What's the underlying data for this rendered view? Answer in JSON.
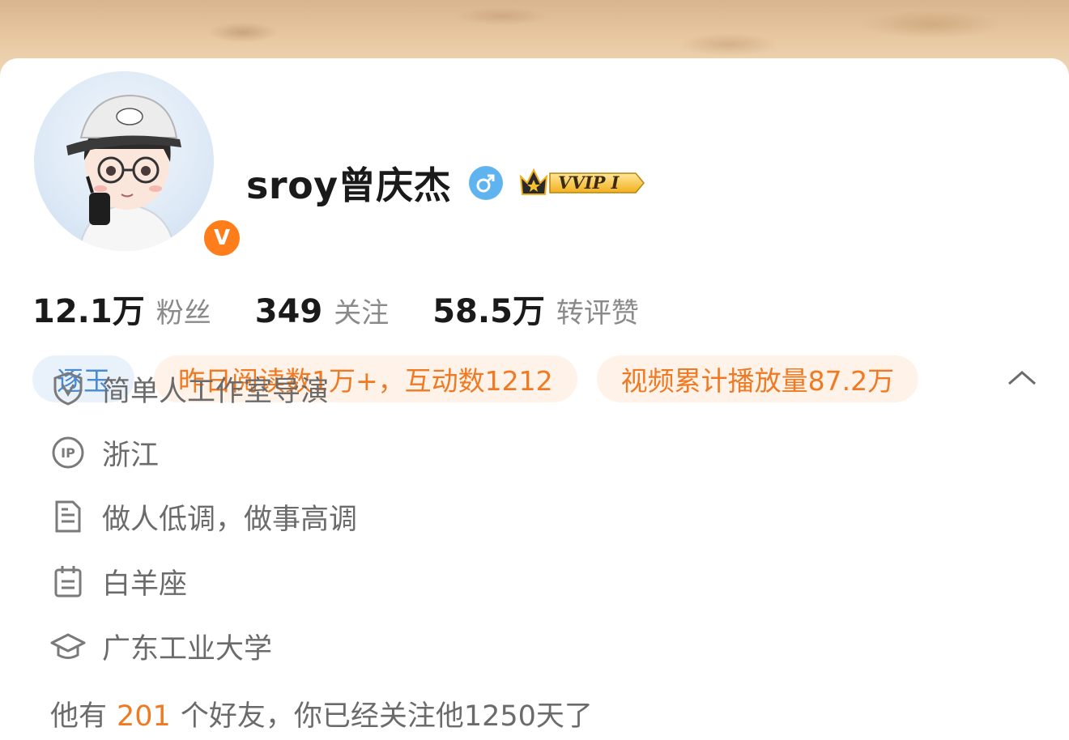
{
  "profile": {
    "name": "sroy曾庆杰",
    "verified_badge": "V",
    "gender": "male",
    "membership": "VVIP I"
  },
  "stats": [
    {
      "value": "12.1万",
      "label": "粉丝"
    },
    {
      "value": "349",
      "label": "关注"
    },
    {
      "value": "58.5万",
      "label": "转评赞"
    }
  ],
  "tags": [
    {
      "text": "逐玉",
      "style": "blue"
    },
    {
      "text": "昨日阅读数1万+，互动数1212",
      "style": "orange"
    },
    {
      "text": "视频累计播放量87.2万",
      "style": "orange"
    }
  ],
  "info": [
    {
      "icon": "verified-shield-icon",
      "text": "简单人工作室导演"
    },
    {
      "icon": "ip-location-icon",
      "text": "浙江"
    },
    {
      "icon": "bio-document-icon",
      "text": "做人低调，做事高调"
    },
    {
      "icon": "calendar-icon",
      "text": "白羊座"
    },
    {
      "icon": "graduation-cap-icon",
      "text": "广东工业大学"
    }
  ],
  "friends": {
    "prefix": "他有",
    "count": "201",
    "suffix": "个好友，你已经关注他1250天了"
  },
  "colors": {
    "accent_orange": "#ef7a23",
    "tag_blue": "#4a8ad0",
    "gender_blue": "#5fb4ef",
    "verified_orange": "#ff7d1a"
  }
}
